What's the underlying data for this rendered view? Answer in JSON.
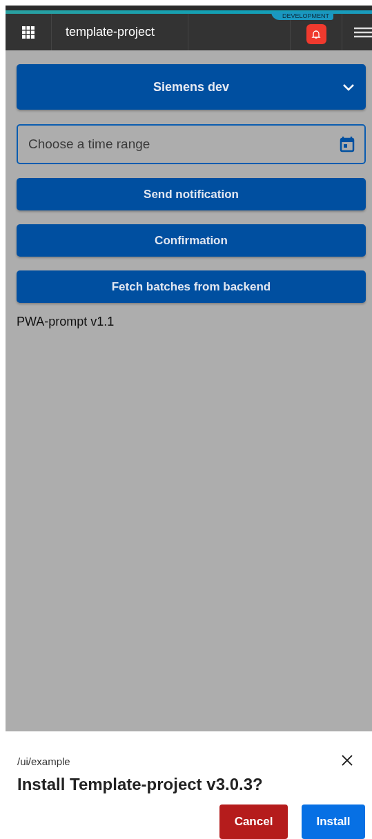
{
  "header": {
    "environment_badge": "DEVELOPMENT",
    "title": "template-project",
    "notification_alert": true
  },
  "controls": [
    {
      "kind": "dropdown",
      "label": "Siemens dev"
    },
    {
      "kind": "date-field",
      "placeholder": "Choose a time range"
    },
    {
      "kind": "button",
      "label": "Send notification"
    },
    {
      "kind": "button",
      "label": "Confirmation"
    },
    {
      "kind": "button",
      "label": "Fetch batches from backend"
    },
    {
      "kind": "text",
      "label": "PWA-prompt v1.1"
    }
  ],
  "install_prompt": {
    "path": "/ui/example",
    "title": "Install Template-project v3.0.3?",
    "buttons": [
      {
        "kind": "cancel",
        "label": "Cancel"
      },
      {
        "kind": "confirm",
        "label": "Install"
      }
    ]
  }
}
